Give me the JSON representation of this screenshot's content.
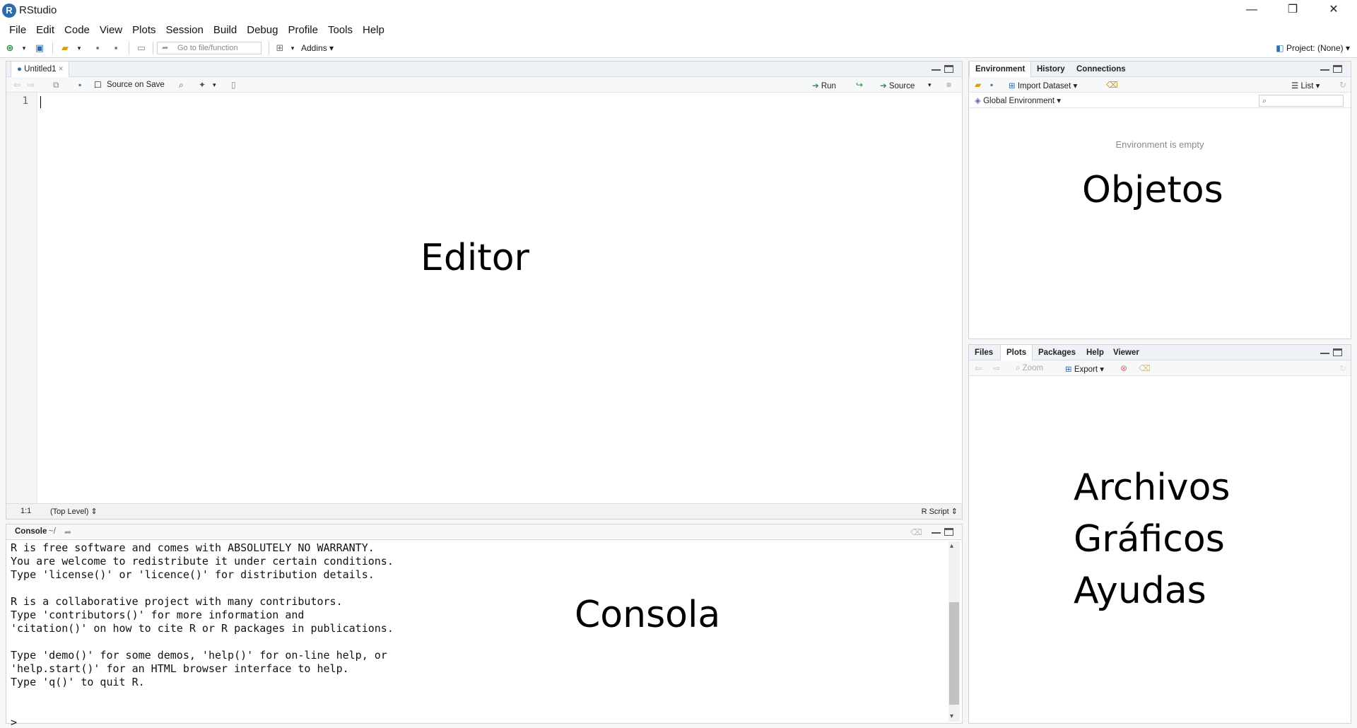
{
  "window": {
    "title": "RStudio",
    "logo_letter": "R",
    "controls": {
      "minimize": "—",
      "maximize": "❐",
      "close": "✕"
    }
  },
  "menu": [
    "File",
    "Edit",
    "Code",
    "View",
    "Plots",
    "Session",
    "Build",
    "Debug",
    "Profile",
    "Tools",
    "Help"
  ],
  "toolbar": {
    "goto_placeholder": "Go to file/function",
    "addins_label": "Addins",
    "project_label": "Project: (None)"
  },
  "editor": {
    "tab_label": "Untitled1",
    "source_on_save_label": "Source on Save",
    "run_label": "Run",
    "source_label": "Source",
    "line_number": "1",
    "cursor_pos": "1:1",
    "scope": "(Top Level)",
    "file_type": "R Script",
    "overlay": "Editor"
  },
  "console": {
    "tab_label": "Console",
    "path": "~/",
    "lines": [
      "R is free software and comes with ABSOLUTELY NO WARRANTY.",
      "You are welcome to redistribute it under certain conditions.",
      "Type 'license()' or 'licence()' for distribution details.",
      "",
      "R is a collaborative project with many contributors.",
      "Type 'contributors()' for more information and",
      "'citation()' on how to cite R or R packages in publications.",
      "",
      "Type 'demo()' for some demos, 'help()' for on-line help, or",
      "'help.start()' for an HTML browser interface to help.",
      "Type 'q()' to quit R.",
      "",
      "",
      "> "
    ],
    "overlay": "Consola"
  },
  "environment": {
    "tabs": [
      "Environment",
      "History",
      "Connections"
    ],
    "import_dataset_label": "Import Dataset",
    "list_label": "List",
    "global_env_label": "Global Environment",
    "empty_message": "Environment is empty",
    "overlay": "Objetos"
  },
  "files": {
    "tabs": [
      "Files",
      "Plots",
      "Packages",
      "Help",
      "Viewer"
    ],
    "zoom_label": "Zoom",
    "export_label": "Export",
    "overlay_lines": [
      "Archivos",
      "Gráficos",
      "Ayudas"
    ]
  },
  "colors": {
    "accent": "#2b6cb0",
    "run_green": "#2e8b3d",
    "pane_header": "#eef1f5"
  }
}
